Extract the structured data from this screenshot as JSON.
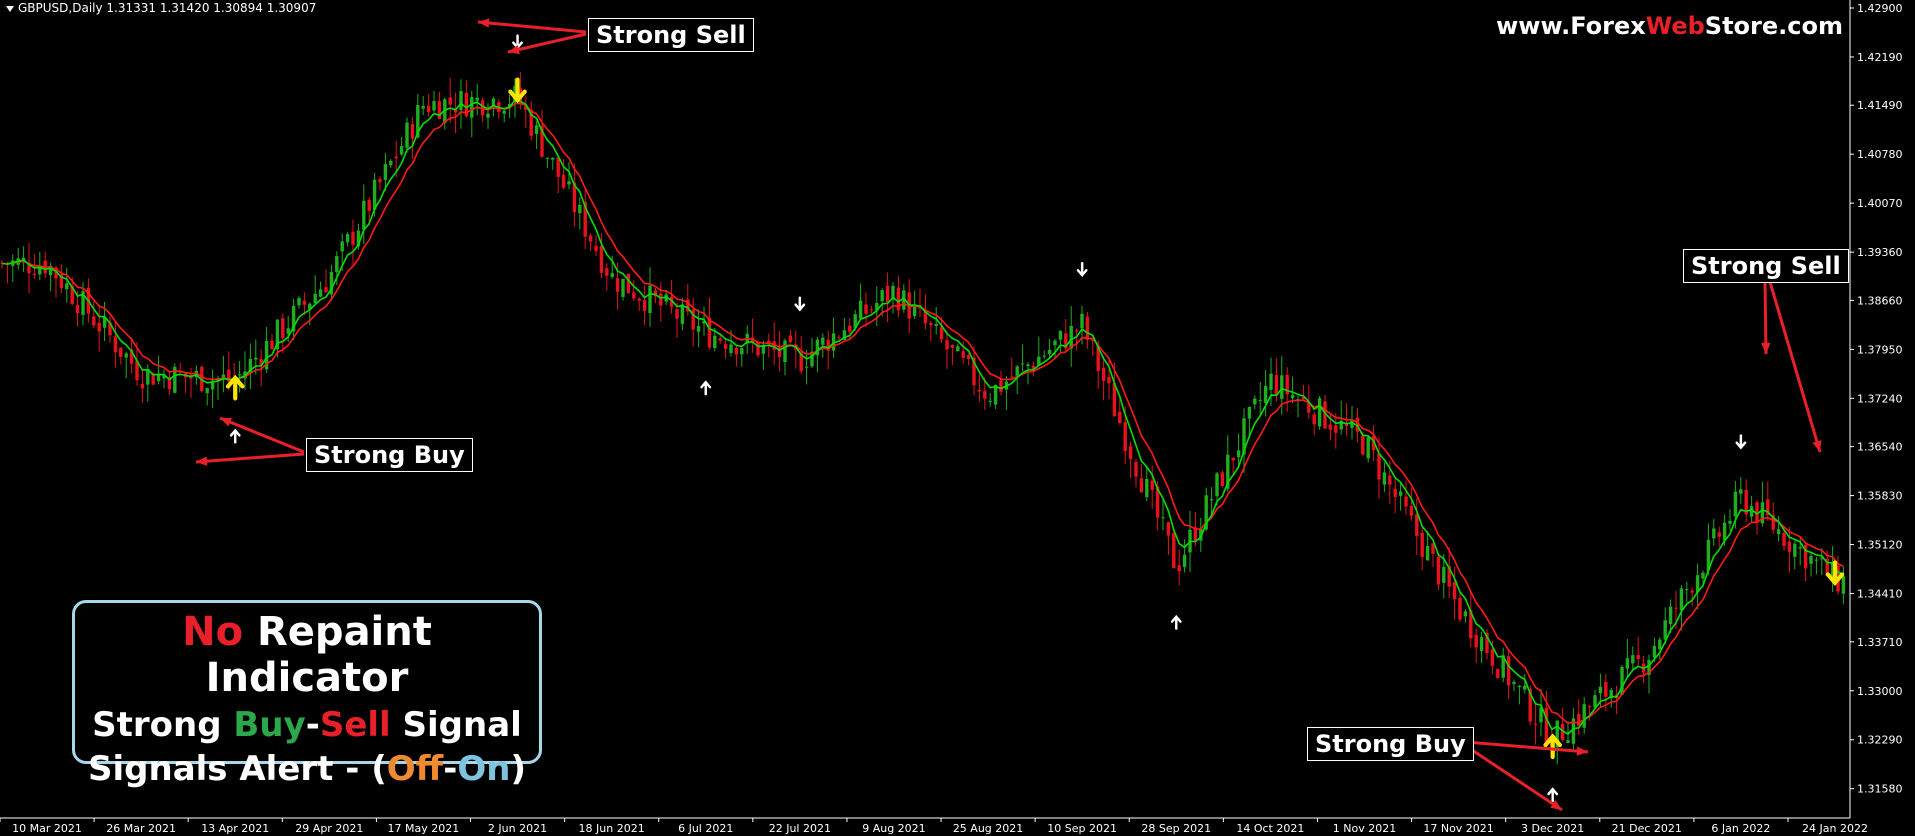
{
  "header": {
    "symbol_line": "GBPUSD,Daily  1.31331 1.31420 1.30894 1.30907",
    "website_prefix": "www.Forex",
    "website_highlight": "Web",
    "website_suffix": "Store.com"
  },
  "callouts": {
    "sell_1": "Strong Sell",
    "buy_1": "Strong Buy",
    "sell_2": "Strong Sell",
    "buy_2": "Strong Buy"
  },
  "info_box": {
    "line1_no": "No",
    "line1_rest": " Repaint Indicator",
    "line2_strong": "Strong ",
    "line2_buy": "Buy",
    "line2_dash": "-",
    "line2_sell": "Sell",
    "line2_rest": " Signal",
    "line3_start": "Signals Alert - (",
    "line3_off": "Off",
    "line3_dash": "-",
    "line3_on": "On",
    "line3_end": ")"
  },
  "colors": {
    "background": "#000000",
    "bull_candle": "#1fae1f",
    "bear_candle": "#e8121e",
    "fast_line": "#00e000",
    "slow_line": "#ff1a1a",
    "signal_arrow": "#ffffff",
    "strong_arrow": "#ffe400",
    "callout_arrow": "#e8202a",
    "axis_text": "#ffffff"
  },
  "chart_data": {
    "type": "candlestick",
    "symbol": "GBPUSD",
    "timeframe": "Daily",
    "ohlc_last": {
      "open": 1.31331,
      "high": 1.3142,
      "low": 1.30894,
      "close": 1.30907
    },
    "y_ticks": [
      "1.42900",
      "1.42190",
      "1.41490",
      "1.40780",
      "1.40070",
      "1.39360",
      "1.38660",
      "1.37950",
      "1.37240",
      "1.36540",
      "1.35830",
      "1.35120",
      "1.34410",
      "1.33710",
      "1.33000",
      "1.32290",
      "1.31580"
    ],
    "ylim": [
      1.313,
      1.429
    ],
    "x_ticks": [
      "10 Mar 2021",
      "26 Mar 2021",
      "13 Apr 2021",
      "29 Apr 2021",
      "17 May 2021",
      "2 Jun 2021",
      "18 Jun 2021",
      "6 Jul 2021",
      "22 Jul 2021",
      "9 Aug 2021",
      "25 Aug 2021",
      "10 Sep 2021",
      "28 Sep 2021",
      "14 Oct 2021",
      "1 Nov 2021",
      "17 Nov 2021",
      "3 Dec 2021",
      "21 Dec 2021",
      "6 Jan 2022",
      "24 Jan 2022"
    ],
    "close_path": [
      {
        "date": "10 Mar 2021",
        "close": 1.392
      },
      {
        "date": "26 Mar 2021",
        "close": 1.376
      },
      {
        "date": "13 Apr 2021",
        "close": 1.375
      },
      {
        "date": "29 Apr 2021",
        "close": 1.39
      },
      {
        "date": "17 May 2021",
        "close": 1.415
      },
      {
        "date": "2 Jun 2021",
        "close": 1.416
      },
      {
        "date": "18 Jun 2021",
        "close": 1.39
      },
      {
        "date": "6 Jul 2021",
        "close": 1.382
      },
      {
        "date": "22 Jul 2021",
        "close": 1.378
      },
      {
        "date": "9 Aug 2021",
        "close": 1.388
      },
      {
        "date": "25 Aug 2021",
        "close": 1.373
      },
      {
        "date": "10 Sep 2021",
        "close": 1.383
      },
      {
        "date": "28 Sep 2021",
        "close": 1.348
      },
      {
        "date": "14 Oct 2021",
        "close": 1.375
      },
      {
        "date": "1 Nov 2021",
        "close": 1.366
      },
      {
        "date": "17 Nov 2021",
        "close": 1.342
      },
      {
        "date": "3 Dec 2021",
        "close": 1.323
      },
      {
        "date": "21 Dec 2021",
        "close": 1.335
      },
      {
        "date": "6 Jan 2022",
        "close": 1.358
      },
      {
        "date": "24 Jan 2022",
        "close": 1.346
      }
    ],
    "signals": [
      {
        "type": "buy",
        "date": "13 Apr 2021"
      },
      {
        "type": "sell",
        "date": "2 Jun 2021"
      },
      {
        "type": "buy",
        "date": "6 Jul 2021"
      },
      {
        "type": "sell",
        "date": "22 Jul 2021"
      },
      {
        "type": "sell",
        "date": "10 Sep 2021"
      },
      {
        "type": "buy",
        "date": "28 Sep 2021"
      },
      {
        "type": "buy",
        "date": "3 Dec 2021"
      },
      {
        "type": "sell",
        "date": "6 Jan 2022"
      }
    ],
    "strong_signals": [
      {
        "type": "buy",
        "date": "13 Apr 2021"
      },
      {
        "type": "sell",
        "date": "2 Jun 2021"
      },
      {
        "type": "buy",
        "date": "3 Dec 2021"
      },
      {
        "type": "sell",
        "date": "24 Jan 2022"
      }
    ]
  }
}
